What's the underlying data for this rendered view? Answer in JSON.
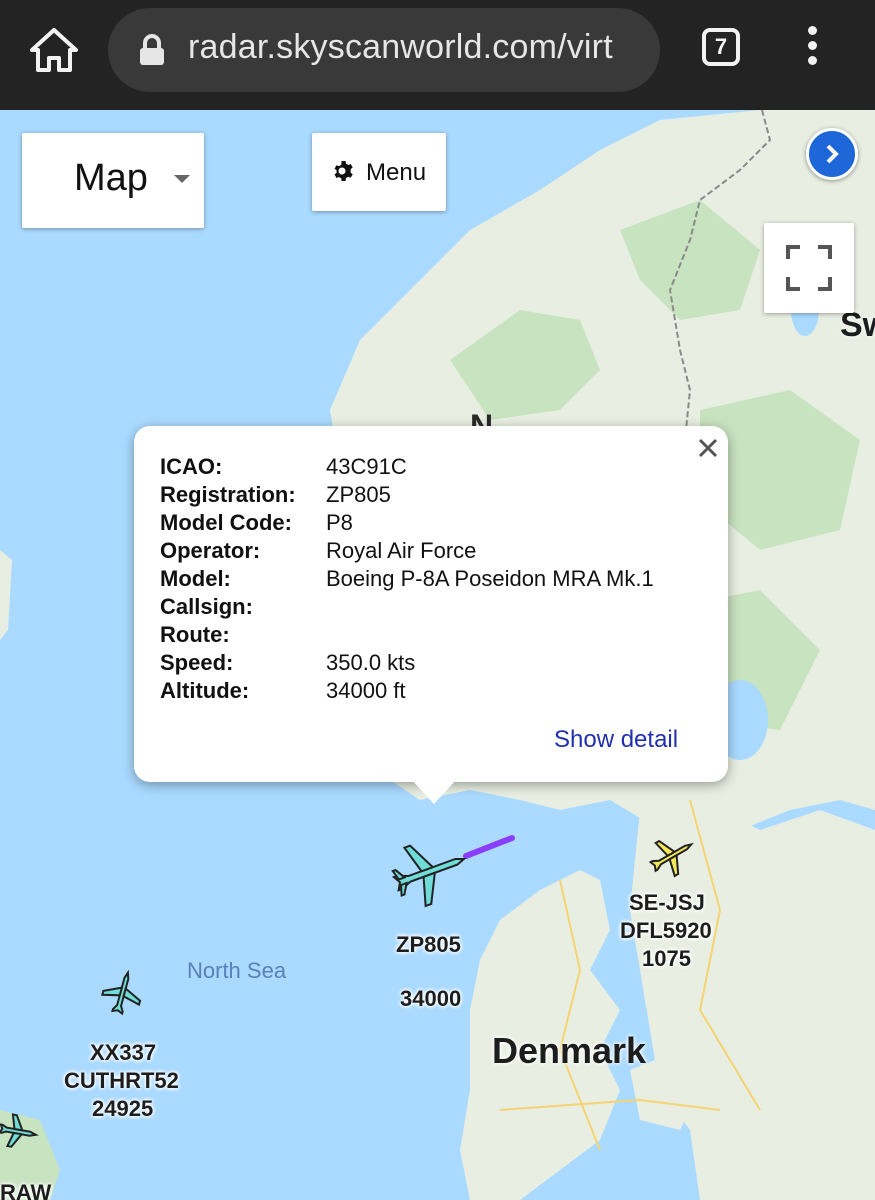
{
  "browser": {
    "url": "radar.skyscanworld.com/virt",
    "tab_count": "7"
  },
  "map": {
    "type_label": "Map",
    "menu_label": "Menu",
    "labels": {
      "north_sea": "North Sea",
      "denmark": "Denmark",
      "sweden_partial": "Sw",
      "norway_partial": "N"
    },
    "colors": {
      "sea": "#aadaff",
      "land": "#e8efe2",
      "forest": "#c8e3c0",
      "border": "#8a8a8a"
    }
  },
  "popup": {
    "rows": [
      {
        "label": "ICAO:",
        "value": "43C91C"
      },
      {
        "label": "Registration:",
        "value": "ZP805"
      },
      {
        "label": "Model Code:",
        "value": "P8"
      },
      {
        "label": "Operator:",
        "value": "Royal Air Force"
      },
      {
        "label": "Model:",
        "value": "Boeing P-8A Poseidon MRA Mk.1"
      },
      {
        "label": "Callsign:",
        "value": ""
      },
      {
        "label": "Route:",
        "value": ""
      },
      {
        "label": "Speed:",
        "value": "350.0 kts"
      },
      {
        "label": "Altitude:",
        "value": "34000 ft"
      }
    ],
    "show_detail": "Show detail"
  },
  "aircraft": [
    {
      "registration": "ZP805",
      "altitude": "34000",
      "color": "#6fdcd8"
    },
    {
      "registration": "SE-JSJ",
      "callsign": "DFL5920",
      "altitude": "1075",
      "color": "#f3e85a"
    },
    {
      "registration": "XX337",
      "callsign": "CUTHRT52",
      "altitude": "24925",
      "color": "#6fdcd8"
    },
    {
      "registration": "RAW",
      "color": "#6fdcd8"
    }
  ]
}
